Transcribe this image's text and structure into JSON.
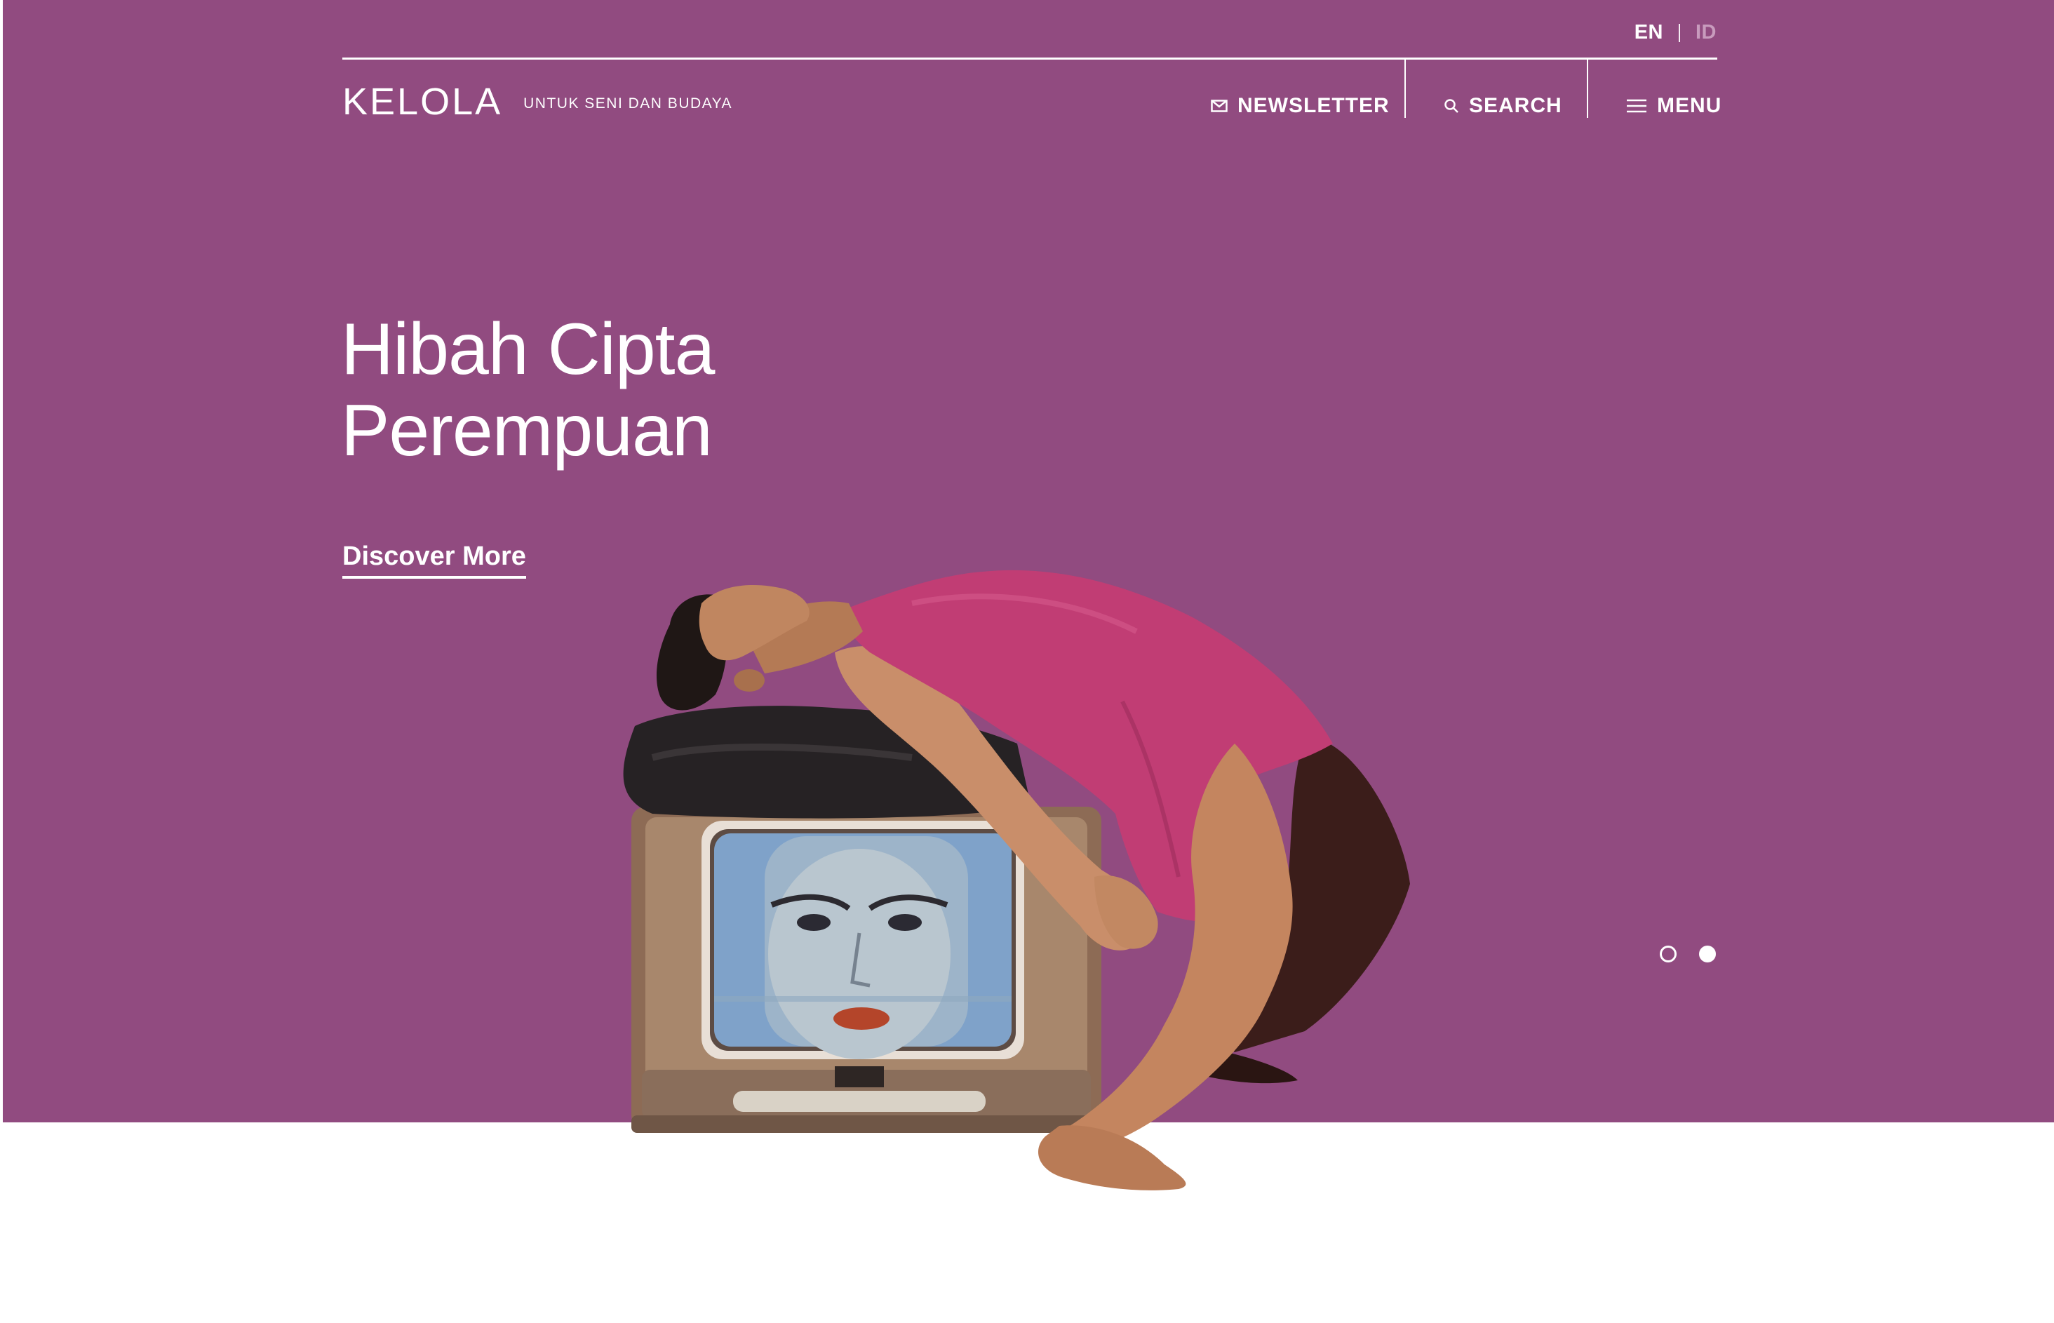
{
  "header": {
    "lang_en": "EN",
    "lang_id": "ID",
    "logo_name": "KELOLA",
    "logo_tagline": "UNTUK SENI DAN BUDAYA",
    "nav": {
      "newsletter": "NEWSLETTER",
      "search": "SEARCH",
      "menu": "MENU"
    }
  },
  "hero": {
    "title_line1": "Hibah Cipta",
    "title_line2": "Perempuan",
    "cta_label": "Discover More",
    "background_color": "#914b80",
    "slides": {
      "count": 2,
      "active_index": 1
    }
  },
  "icons": {
    "newsletter": "envelope-icon",
    "search": "magnifier-icon",
    "menu": "hamburger-icon"
  }
}
